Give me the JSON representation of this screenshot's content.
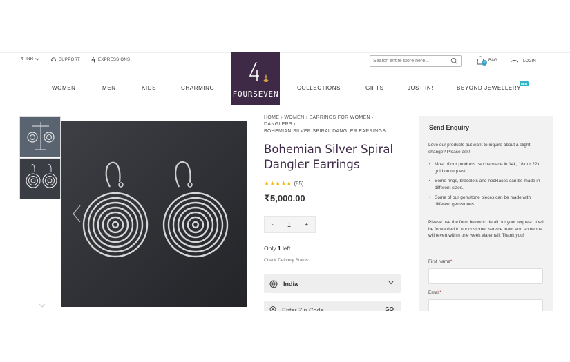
{
  "topbar": {
    "currency": "INR",
    "support": "SUPPORT",
    "expressions": "EXPRESSIONS",
    "search_placeholder": "Search entire store here...",
    "bag_label": "BAG",
    "bag_count": "0",
    "login_label": "LOGIN"
  },
  "logo": {
    "brand": "FOURSEVEN"
  },
  "nav": {
    "items": [
      "WOMEN",
      "MEN",
      "KIDS",
      "CHARMING",
      "COLLECTIONS",
      "GIFTS",
      "JUST IN!",
      "BEYOND JEWELLERY"
    ],
    "new_badge": "NEW"
  },
  "product": {
    "breadcrumb_line1": "HOME  ›  WOMEN  ›  EARRINGS FOR WOMEN  ›",
    "breadcrumb_line2": "DANGLERS  ›",
    "breadcrumb_line3": "BOHEMIAN SILVER SPIRAL DANGLER EARRINGS",
    "title": "Bohemian Silver Spiral Dangler Earrings",
    "stars": "★★★★★",
    "rating_count": "(85)",
    "rating_value": 5,
    "price": "₹5,000.00",
    "qty_minus": "-",
    "qty_value": "1",
    "qty_plus": "+",
    "stock_prefix": "Only ",
    "stock_count": "1",
    "stock_suffix": " left",
    "check_delivery": "Check Delivery Status",
    "country": "India",
    "zip_placeholder": "Enter Zip Code",
    "zip_go": "GO"
  },
  "enquiry": {
    "title": "Send Enquiry",
    "intro": "Love our products but want to inquire about a slight change? Please ask!",
    "bullets": [
      "Most of our products can be made in 14k, 18k or 22k gold on request.",
      "Some rings, bracelets and necklaces can be made in different sizes.",
      "Some of our gemstone pieces can be made with different gemstones."
    ],
    "instructions": "Please use the form below to detail out your request. It will be forwarded to our customer service team and someone will revert within one week via email. Thank you!",
    "first_name_label": "First Name",
    "email_label": "Email",
    "required_mark": "*"
  },
  "colors": {
    "brand": "#3e2a47",
    "star": "#f4b400",
    "badge": "#2fb5c8"
  }
}
